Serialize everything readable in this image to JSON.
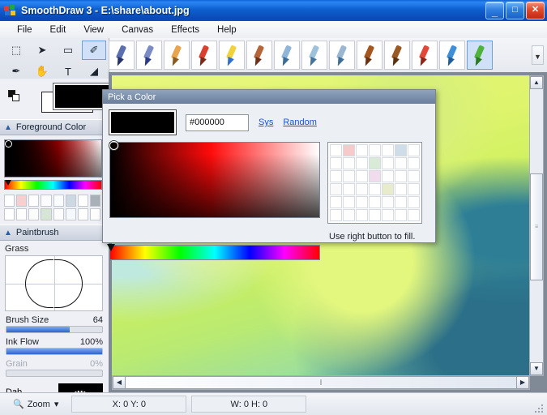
{
  "window": {
    "title": "SmoothDraw 3 - E:\\share\\about.jpg",
    "app_icon": "smoothdraw-logo-icon",
    "buttons": {
      "minimize": "_",
      "maximize": "□",
      "close": "✕"
    }
  },
  "menu": {
    "items": [
      {
        "label": "File"
      },
      {
        "label": "Edit"
      },
      {
        "label": "View"
      },
      {
        "label": "Canvas"
      },
      {
        "label": "Effects"
      },
      {
        "label": "Help"
      }
    ]
  },
  "tools": {
    "items": [
      {
        "name": "marquee-select-tool",
        "glyph": "⬚",
        "selected": false
      },
      {
        "name": "move-tool",
        "glyph": "➤",
        "selected": false
      },
      {
        "name": "eraser-tool",
        "glyph": "▭",
        "selected": false
      },
      {
        "name": "paintbrush-tool",
        "glyph": "✐",
        "selected": true
      },
      {
        "name": "eyedropper-tool",
        "glyph": "✒",
        "selected": false
      },
      {
        "name": "hand-tool",
        "glyph": "✋",
        "selected": false
      },
      {
        "name": "text-tool",
        "glyph": "T",
        "selected": false
      },
      {
        "name": "smudge-tool",
        "glyph": "◢",
        "selected": false
      }
    ]
  },
  "brush_toolbar": {
    "overflow_glyph": "▼",
    "items": [
      {
        "name": "pen-brush",
        "shaft": "#5b6fae",
        "tip": "#26306b",
        "selected": false
      },
      {
        "name": "ink-pen-brush",
        "shaft": "#7b8cc4",
        "tip": "#2b3a86",
        "selected": false
      },
      {
        "name": "pencil-brush",
        "shaft": "#e8a54e",
        "tip": "#8a5a1e",
        "selected": false
      },
      {
        "name": "red-pencil-brush",
        "shaft": "#d94030",
        "tip": "#7d2a18",
        "selected": false
      },
      {
        "name": "crayon-brush",
        "shaft": "#f2d23c",
        "tip": "#2f6fd0",
        "selected": false
      },
      {
        "name": "marker-brush",
        "shaft": "#b4663a",
        "tip": "#6e2f16",
        "selected": false
      },
      {
        "name": "airbrush-brush",
        "shaft": "#8fb6d8",
        "tip": "#3c6d99",
        "selected": false
      },
      {
        "name": "spatter-brush",
        "shaft": "#9fc2dc",
        "tip": "#44739c",
        "selected": false
      },
      {
        "name": "fan-brush",
        "shaft": "#9ab6d0",
        "tip": "#3e6e97",
        "selected": false
      },
      {
        "name": "oil-brush",
        "shaft": "#a4561f",
        "tip": "#6a3010",
        "selected": false
      },
      {
        "name": "wet-brush",
        "shaft": "#9a5a24",
        "tip": "#5e3210",
        "selected": false
      },
      {
        "name": "eraser-brush",
        "shaft": "#e0483a",
        "tip": "#8f2417",
        "selected": false
      },
      {
        "name": "blur-brush",
        "shaft": "#3f8fd8",
        "tip": "#1e5c9c",
        "selected": false
      },
      {
        "name": "grass-brush",
        "shaft": "#4fb23a",
        "tip": "#2c7a1f",
        "selected": true
      }
    ]
  },
  "color_chips": {
    "foreground": "#000000",
    "background": "#ffffff",
    "swap_icon": "swap-colors-icon"
  },
  "foreground_panel": {
    "title": "Foreground Color",
    "collapse_icon": "chevron-up-icon",
    "swatches": [
      "#ffffff",
      "#f6cfcf",
      "#ffffff",
      "#fcfcff",
      "#fbfcfd",
      "#ccd8e2",
      "#ffffff",
      "#a9b0b8",
      "#ffffff",
      "#fdfdfe",
      "#fbfdfb",
      "#d6e6d2",
      "#fdfdfd",
      "#f5f8fc",
      "#ffffff",
      "#fdfdfd"
    ]
  },
  "paintbrush_panel": {
    "title": "Paintbrush",
    "collapse_icon": "chevron-up-icon",
    "brush_name": "Grass",
    "brush_size": {
      "label": "Brush Size",
      "value": "64",
      "percent": 66
    },
    "ink_flow": {
      "label": "Ink Flow",
      "value": "100%",
      "percent": 100
    },
    "grain": {
      "label": "Grain",
      "value": "0%",
      "percent": 0,
      "disabled": true
    },
    "dab": {
      "label": "Dab"
    }
  },
  "dialog": {
    "title": "Pick a Color",
    "current_color": "#000000",
    "hex_value": "#000000",
    "hex_placeholder": "#000000",
    "links": [
      {
        "label": "Sys",
        "name": "sys-colors-link"
      },
      {
        "label": "Random",
        "name": "random-color-link"
      }
    ],
    "hint": "Use right button to fill.",
    "palette": [
      "#ffffff",
      "#f7c9cb",
      "#ffffff",
      "#fdfdfe",
      "#fefefe",
      "#cfdde8",
      "#ffffff",
      "#ffffff",
      "#fefefe",
      "#ffffff",
      "#d9ead6",
      "#ffffff",
      "#fdfdfd",
      "#ffffff",
      "#ffffff",
      "#fdfdfd",
      "#ffffff",
      "#f0dced",
      "#fefefe",
      "#ffffff",
      "#fefefe",
      "#fafafa",
      "#ffffff",
      "#fdfdfd",
      "#ffffff",
      "#e8eccd",
      "#ffffff",
      "#ffffff",
      "#ffffff",
      "#ffffff",
      "#fefefe",
      "#ffffff",
      "#fdfdfd",
      "#ffffff",
      "#ffffff",
      "#ffffff",
      "#fdfdfd",
      "#ffffff",
      "#ffffff",
      "#fefefe",
      "#ffffff",
      "#ffffff"
    ]
  },
  "canvas": {
    "image_name": "about-jpg-flower-image",
    "scroll_up_glyph": "▲",
    "scroll_down_glyph": "▼",
    "scroll_left_glyph": "◀",
    "scroll_right_glyph": "▶"
  },
  "status_bar": {
    "zoom_icon": "magnifier-icon",
    "zoom_label": "Zoom",
    "zoom_arrow": "▾",
    "coords": "X: 0 Y: 0",
    "size": "W: 0 H: 0"
  },
  "colors": {
    "title_blue": "#0e5fd0",
    "accent_link": "#1b4fd8",
    "panel_bg": "#eef0f5",
    "selection": "#cfe0f7"
  }
}
